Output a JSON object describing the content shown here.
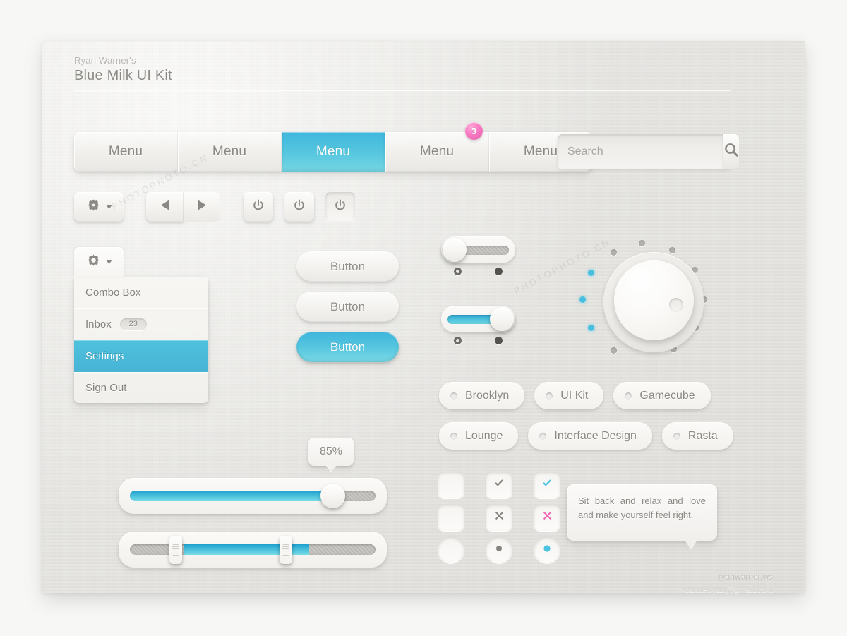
{
  "header": {
    "eyebrow": "Ryan Warner's",
    "title": "Blue Milk UI Kit"
  },
  "menubar": {
    "items": [
      {
        "label": "Menu",
        "active": false,
        "badge": null
      },
      {
        "label": "Menu",
        "active": false,
        "badge": null
      },
      {
        "label": "Menu",
        "active": true,
        "badge": null
      },
      {
        "label": "Menu",
        "active": false,
        "badge": "3"
      },
      {
        "label": "Menu",
        "active": false,
        "badge": null
      }
    ],
    "badge_color": "#ef6fb8",
    "active_color": "#52c4de"
  },
  "search": {
    "value": "",
    "placeholder": "Search",
    "button_icon": "search-icon"
  },
  "toolbar": {
    "gear": {
      "icon": "gear-icon",
      "caret": "chevron-down-icon"
    },
    "nav_prev_icon": "triangle-left-icon",
    "nav_next_icon": "triangle-right-icon",
    "power_buttons": [
      {
        "icon": "power-icon",
        "state": "normal"
      },
      {
        "icon": "power-icon",
        "state": "normal"
      },
      {
        "icon": "power-icon",
        "state": "pressed"
      }
    ]
  },
  "combo": {
    "head_icon": "gear-icon",
    "head_caret": "chevron-down-icon",
    "options": [
      {
        "label": "Combo Box",
        "badge": null,
        "selected": false
      },
      {
        "label": "Inbox",
        "badge": "23",
        "selected": false
      },
      {
        "label": "Settings",
        "badge": null,
        "selected": true
      },
      {
        "label": "Sign Out",
        "badge": null,
        "selected": false
      }
    ]
  },
  "buttons": [
    {
      "label": "Button",
      "style": "light"
    },
    {
      "label": "Button",
      "style": "light"
    },
    {
      "label": "Button",
      "style": "blue"
    }
  ],
  "toggles": [
    {
      "state": "off",
      "left_dot": "hollow",
      "right_dot": "solid"
    },
    {
      "state": "on",
      "left_dot": "hollow",
      "right_dot": "solid"
    }
  ],
  "dial": {
    "name": "rotary-knob",
    "lit_dots": 3,
    "total_dots": 11,
    "lit_color": "#49bfe0",
    "off_color": "#b3b1ac"
  },
  "tags": {
    "row1": [
      "Brooklyn",
      "UI Kit",
      "Gamecube"
    ],
    "row2": [
      "Lounge",
      "Interface Design",
      "Rasta"
    ]
  },
  "slider": {
    "value_label": "85%",
    "fill_percent": 85
  },
  "range_slider": {
    "start_percent": 22,
    "end_percent": 73
  },
  "checkgrid": [
    [
      {
        "shape": "square",
        "mark": "none",
        "color": "none"
      },
      {
        "shape": "square",
        "mark": "check",
        "color": "#85837e"
      },
      {
        "shape": "square",
        "mark": "check",
        "color": "#4cc3e0"
      }
    ],
    [
      {
        "shape": "square",
        "mark": "none",
        "color": "none"
      },
      {
        "shape": "square",
        "mark": "x",
        "color": "#85837e"
      },
      {
        "shape": "square",
        "mark": "x",
        "color": "#f263b2"
      }
    ],
    [
      {
        "shape": "circle",
        "mark": "none",
        "color": "none"
      },
      {
        "shape": "circle",
        "mark": "dot",
        "color": "#85837e"
      },
      {
        "shape": "circle",
        "mark": "dot",
        "color": "#4cc3e0"
      }
    ]
  ],
  "tooltip": {
    "text": "Sit back and relax and love and make yourself feel right."
  },
  "footer": {
    "site": "ryanwarner.ws",
    "email": "warnerryan@gmail.com"
  },
  "watermarks": [
    "PHOTOPHOTO.CN",
    "PHOTOPHOTO.CN"
  ]
}
